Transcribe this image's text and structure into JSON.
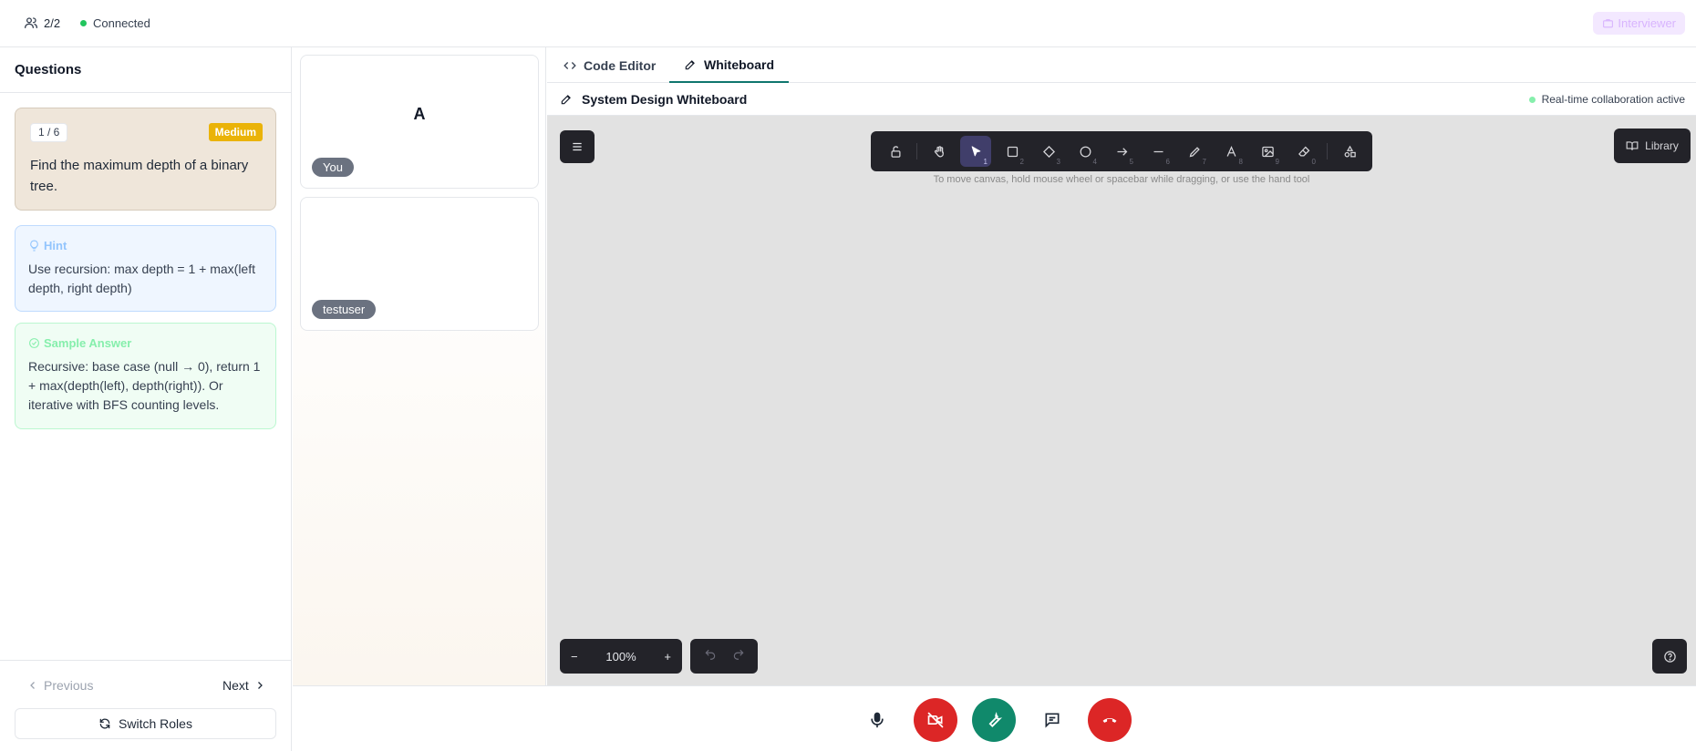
{
  "topbar": {
    "participant_count": "2/2",
    "connection_status": "Connected",
    "role_button": "Interviewer"
  },
  "questions": {
    "title": "Questions",
    "counter": "1 / 6",
    "difficulty": "Medium",
    "question_text": "Find the maximum depth of a binary tree.",
    "hint_label": "Hint",
    "hint_text": "Use recursion: max depth = 1 + max(left depth, right depth)",
    "sample_label": "Sample Answer",
    "sample_text": "Recursive: base case (null → 0), return 1 + max(depth(left), depth(right)). Or iterative with BFS counting levels.",
    "prev_label": "Previous",
    "next_label": "Next",
    "switch_label": "Switch Roles"
  },
  "videos": [
    {
      "avatar": "A",
      "name": "You"
    },
    {
      "avatar": "",
      "name": "testuser"
    }
  ],
  "tabs": {
    "code_editor": "Code Editor",
    "whiteboard": "Whiteboard"
  },
  "whiteboard": {
    "title": "System Design Whiteboard",
    "collab_status": "Real-time collaboration active",
    "canvas_hint": "To move canvas, hold mouse wheel or spacebar while dragging, or use the hand tool",
    "library_label": "Library",
    "zoom_level": "100%",
    "tool_keys": {
      "select": "1",
      "rectangle": "2",
      "diamond": "3",
      "ellipse": "4",
      "arrow": "5",
      "line": "6",
      "draw": "7",
      "text": "8",
      "image": "9",
      "eraser": "0"
    }
  },
  "colors": {
    "accent_tab": "#0f766e",
    "status_green": "#22c55e",
    "danger": "#dc2626",
    "tool_active": "#403e6a"
  }
}
